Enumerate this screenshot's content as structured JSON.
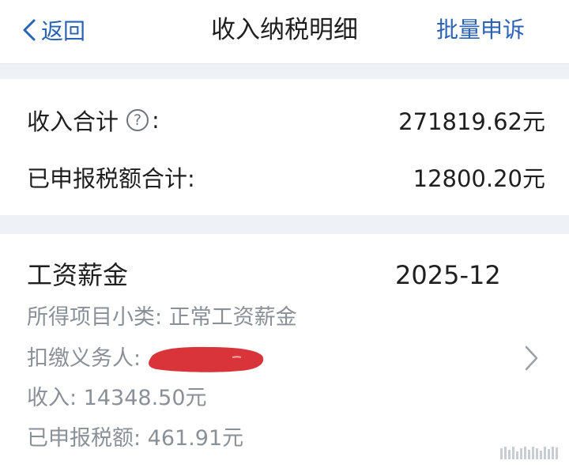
{
  "nav": {
    "back_label": "返回",
    "title": "收入纳税明细",
    "batch_appeal_label": "批量申诉"
  },
  "summary": {
    "income_total_label": "收入合计",
    "income_total_suffix": ":",
    "income_total_value": "271819.62元",
    "tax_total_label": "已申报税额合计:",
    "tax_total_value": "12800.20元"
  },
  "record": {
    "title": "工资薪金",
    "period": "2025-12",
    "subcategory_text": "所得项目小类: 正常工资薪金",
    "withholder_label": "扣缴义务人:",
    "income_text": "收入: 14348.50元",
    "tax_text": "已申报税额: 461.91元"
  },
  "colors": {
    "accent": "#2a62b6",
    "redaction": "#d8343a",
    "background": "#eef1f6"
  }
}
